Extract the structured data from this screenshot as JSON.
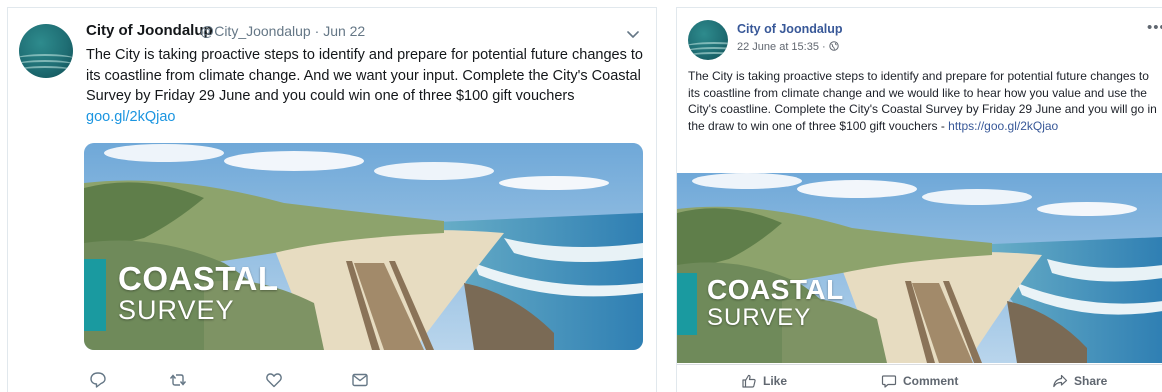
{
  "twitter": {
    "display_name": "City of Joondalup",
    "handle": "@City_Joondalup",
    "date": "Jun 22",
    "text": "The City is taking proactive steps to identify and prepare for potential future changes to its coastline from climate change. And we want your input. Complete the City's Coastal Survey by Friday 29 June and you could win one of three $100 gift vouchers ",
    "link": "goo.gl/2kQjao",
    "actions": [
      "reply-icon",
      "retweet-icon",
      "like-icon",
      "message-icon"
    ]
  },
  "facebook": {
    "page_name": "City of Joondalup",
    "timestamp": "22 June at 15:35 ·",
    "text": "The City is taking proactive steps to identify and prepare for potential future changes to its coastline from climate change and we would like to hear how you value and use the City's coastline. Complete the City's Coastal Survey by Friday 29 June and you will go in the draw to win one of three $100 gift vouchers - ",
    "link": "https://goo.gl/2kQjao",
    "actions": {
      "like": "Like",
      "comment": "Comment",
      "share": "Share"
    }
  },
  "image": {
    "title": "COASTAL",
    "subtitle": "SURVEY"
  },
  "avatar_text": "City of Joondalup",
  "colors": {
    "badge_teal": "#1a9aa0",
    "twitter_link": "#1b95e0",
    "facebook_link": "#385898"
  }
}
